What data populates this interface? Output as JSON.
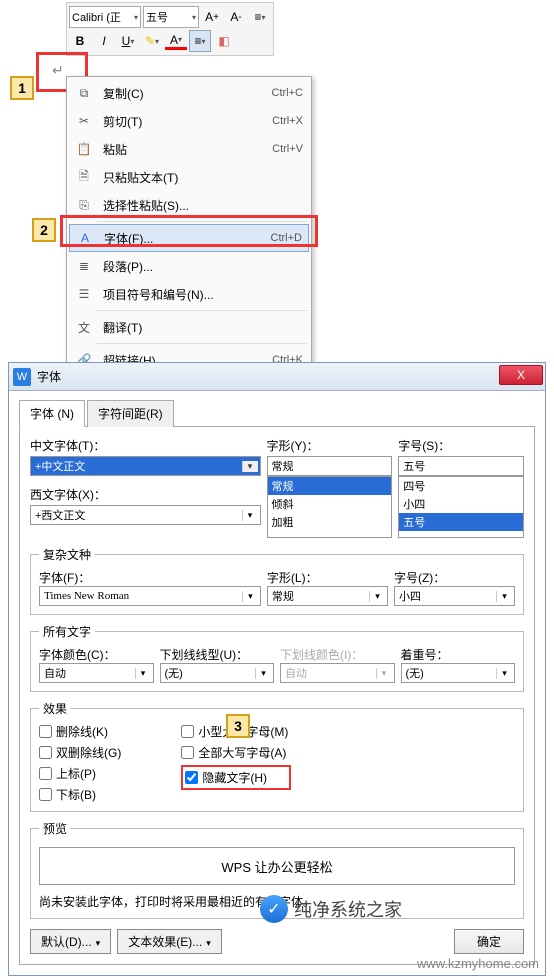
{
  "toolbar": {
    "font": "Calibri (正",
    "size": "五号",
    "bold": "B",
    "italic": "I",
    "underline": "U"
  },
  "markers": {
    "m1": "1",
    "m2": "2",
    "m3": "3"
  },
  "ctx": {
    "copy": {
      "label": "复制(C)",
      "short": "Ctrl+C"
    },
    "cut": {
      "label": "剪切(T)",
      "short": "Ctrl+X"
    },
    "paste": {
      "label": "粘贴",
      "short": "Ctrl+V"
    },
    "paste_text": {
      "label": "只粘贴文本(T)"
    },
    "paste_special": {
      "label": "选择性粘贴(S)..."
    },
    "font": {
      "label": "字体(F)...",
      "short": "Ctrl+D"
    },
    "paragraph": {
      "label": "段落(P)..."
    },
    "bullets": {
      "label": "项目符号和编号(N)..."
    },
    "translate": {
      "label": "翻译(T)"
    },
    "hyperlink": {
      "label": "超链接(H)...",
      "short": "Ctrl+K"
    }
  },
  "dlg": {
    "title": "字体",
    "tabs": {
      "font": "字体 (N)",
      "spacing": "字符间距(R)"
    },
    "cjk_font_label": "中文字体(T)：",
    "cjk_font_value": "+中文正文",
    "latin_font_label": "西文字体(X)：",
    "latin_font_value": "+西文正文",
    "style_label": "字形(Y)：",
    "style_value": "常规",
    "style_opts": [
      "常规",
      "倾斜",
      "加粗"
    ],
    "size_label": "字号(S)：",
    "size_value": "五号",
    "size_opts": [
      "四号",
      "小四",
      "五号"
    ],
    "complex": {
      "legend": "复杂文种",
      "font_label": "字体(F)：",
      "font_value": "Times New Roman",
      "style_label": "字形(L)：",
      "style_value": "常规",
      "size_label": "字号(Z)：",
      "size_value": "小四"
    },
    "all_text": {
      "legend": "所有文字",
      "color_label": "字体颜色(C)：",
      "color_value": "自动",
      "underline_label": "下划线线型(U)：",
      "underline_value": "(无)",
      "ul_color_label": "下划线颜色(I)：",
      "ul_color_value": "自动",
      "emphasis_label": "着重号：",
      "emphasis_value": "(无)"
    },
    "effects": {
      "legend": "效果",
      "strike": "删除线(K)",
      "dbl_strike": "双删除线(G)",
      "super": "上标(P)",
      "sub": "下标(B)",
      "small_caps": "小型大写字母(M)",
      "all_caps": "全部大写字母(A)",
      "hidden": "隐藏文字(H)"
    },
    "preview": {
      "legend": "预览",
      "text": "WPS 让办公更轻松"
    },
    "note": "尚未安装此字体，打印时将采用最相近的有效字体。",
    "btn_default": "默认(D)...",
    "btn_texteffect": "文本效果(E)...",
    "btn_ok": "确定",
    "close_x": "X"
  },
  "watermark": "www.kzmyhome.com",
  "footer": "纯净系统之家"
}
